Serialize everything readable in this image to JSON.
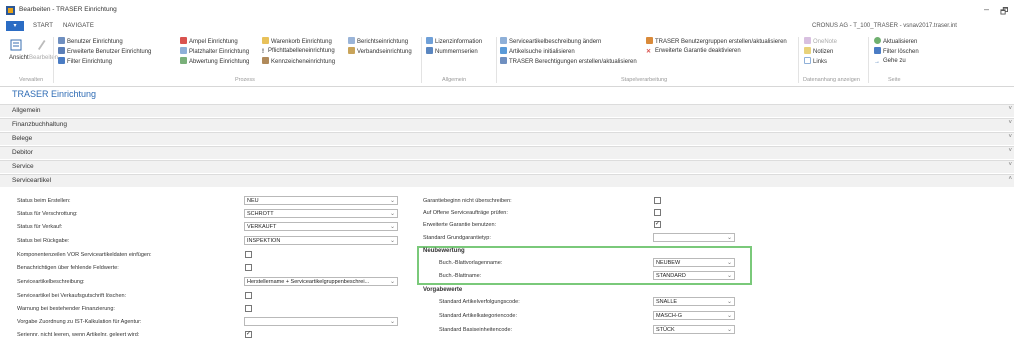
{
  "window": {
    "title": "Bearbeiten - TRASER Einrichtung",
    "minimize": "–",
    "restore": "🗗"
  },
  "tabs": [
    "START",
    "NAVIGATE"
  ],
  "company": "CRONUS AG - T_100_TRASER - vsnav2017.traser.int",
  "ribbon": {
    "ansicht": "Ansicht",
    "bearbeiten": "Bearbeiten",
    "verwalten_group": "Verwalten",
    "p1": [
      "Benutzer Einrichtung",
      "Erweiterte Benutzer Einrichtung",
      "Filter Einrichtung"
    ],
    "p2": [
      "Ampel Einrichtung",
      "Platzhalter Einrichtung",
      "Abwertung Einrichtung"
    ],
    "p3": [
      "Warenkorb Einrichtung",
      "Pflichttabelleneinrichtung",
      "Kennzeicheneinrichtung"
    ],
    "p4": [
      "Berichtseinrichtung",
      "Verbandseinrichtung"
    ],
    "prozess_group": "Prozess",
    "a1": [
      "Lizenzinformation",
      "Nummernserien"
    ],
    "allgemein_group": "Allgemein",
    "s1": [
      "Serviceartikelbeschreibung ändern",
      "Artikelsuche initialisieren",
      "TRASER Berechtigungen erstellen/aktualisieren"
    ],
    "s2": [
      "TRASER Benutzergruppen erstellen/aktualisieren",
      "Erweiterte Garantie deaktivieren"
    ],
    "stapel_group": "Stapelverarbeitung",
    "d1": [
      "OneNote",
      "Notizen",
      "Links"
    ],
    "daten_group": "Datenanhang anzeigen",
    "e1": [
      "Aktualisieren",
      "Filter löschen",
      "Gehe zu"
    ],
    "seite_group": "Seite"
  },
  "page_title": "TRASER Einrichtung",
  "fasttabs": [
    "Allgemein",
    "Finanzbuchhaltung",
    "Belege",
    "Debitor",
    "Service",
    "Serviceartikel"
  ],
  "left_fields": [
    {
      "label": "Status beim Erstellen:",
      "value": "NEU",
      "type": "select"
    },
    {
      "label": "Status für Verschrottung:",
      "value": "SCHROTT",
      "type": "select"
    },
    {
      "label": "Status für Verkauf:",
      "value": "VERKAUFT",
      "type": "select"
    },
    {
      "label": "Status bei Rückgabe:",
      "value": "INSPEKTION",
      "type": "select"
    },
    {
      "label": "Komponentenzeilen VOR Serviceartikeldaten einfügen:",
      "value": "",
      "type": "check"
    },
    {
      "label": "Benachrichtigen über fehlende Feldwerte:",
      "value": "",
      "type": "check"
    },
    {
      "label": "Serviceartikelbeschreibung:",
      "value": "Herstellername + Serviceartikelgruppenbeschrei...",
      "type": "select"
    },
    {
      "label": "Serviceartikel bei Verkaufsgutschrift löschen:",
      "value": "",
      "type": "check"
    },
    {
      "label": "Warnung bei bestehender Finanzierung:",
      "value": "",
      "type": "check"
    },
    {
      "label": "Vorgabe Zuordnung zu IST-Kalkulation für Agentur:",
      "value": "",
      "type": "select"
    },
    {
      "label": "Seriennr. nicht leeren, wenn Artikelnr. geleert wird:",
      "value": "✓",
      "type": "check"
    }
  ],
  "right_fields": [
    {
      "label": "Garantiebeginn nicht überschreiben:",
      "value": "",
      "type": "check"
    },
    {
      "label": "Auf Offene Serviceaufträge prüfen:",
      "value": "",
      "type": "check"
    },
    {
      "label": "Erweiterte Garantie benutzen:",
      "value": "✓",
      "type": "check"
    },
    {
      "label": "Standard Grundgarantietyp:",
      "value": "",
      "type": "select"
    }
  ],
  "neubewertung": {
    "header": "Neubewertung",
    "fields": [
      {
        "label": "Buch.-Blattvorlagenname:",
        "value": "NEUBEW"
      },
      {
        "label": "Buch.-Blattname:",
        "value": "STANDARD"
      }
    ]
  },
  "vorgabewerte": {
    "header": "Vorgabewerte",
    "fields": [
      {
        "label": "Standard Artikelverfolgungscode:",
        "value": "SNALLE"
      },
      {
        "label": "Standard Artikelkategoriencode:",
        "value": "MASCH-G"
      },
      {
        "label": "Standard Basiseinheitencode:",
        "value": "STÜCK"
      }
    ]
  },
  "colors": {
    "accent": "#2b6cc4",
    "title": "#2f6cb5",
    "highlight": "#7ac97a"
  }
}
